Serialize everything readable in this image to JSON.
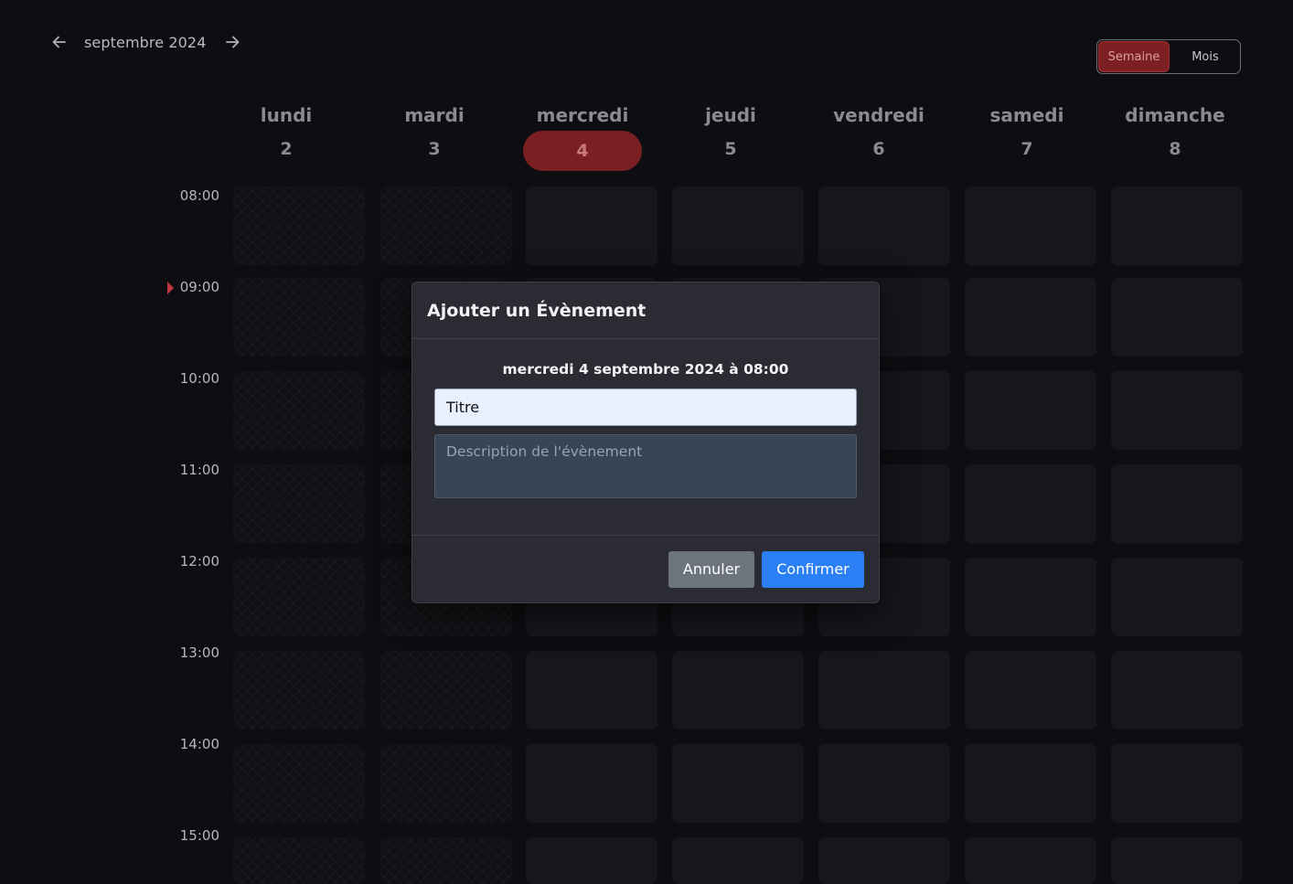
{
  "header": {
    "month_label": "septembre 2024",
    "prev_icon": "arrow-left-icon",
    "next_icon": "arrow-right-icon"
  },
  "view_toggle": {
    "options": [
      "Semaine",
      "Mois"
    ],
    "selected": "Semaine"
  },
  "week": {
    "days": [
      {
        "name": "lundi",
        "number": "2"
      },
      {
        "name": "mardi",
        "number": "3"
      },
      {
        "name": "mercredi",
        "number": "4"
      },
      {
        "name": "jeudi",
        "number": "5"
      },
      {
        "name": "vendredi",
        "number": "6"
      },
      {
        "name": "samedi",
        "number": "7"
      },
      {
        "name": "dimanche",
        "number": "8"
      }
    ],
    "today_index": 2,
    "past_day_count": 2
  },
  "time_slots": [
    "08:00",
    "09:00",
    "10:00",
    "11:00",
    "12:00",
    "13:00",
    "14:00",
    "15:00"
  ],
  "current_time_marker_slot": "09:00",
  "modal": {
    "title": "Ajouter un Évènement",
    "date_text": "mercredi 4 septembre 2024 à 08:00",
    "title_input_value": "Titre",
    "description_placeholder": "Description de l'évènement",
    "cancel_label": "Annuler",
    "confirm_label": "Confirmer"
  },
  "colors": {
    "background": "#0e0e12",
    "accent_today": "#7a1f22",
    "toggle_active": "#7d1f23",
    "confirm_button": "#2b7ff5",
    "cancel_button": "#6c757d",
    "modal_background": "#2a2b33"
  }
}
